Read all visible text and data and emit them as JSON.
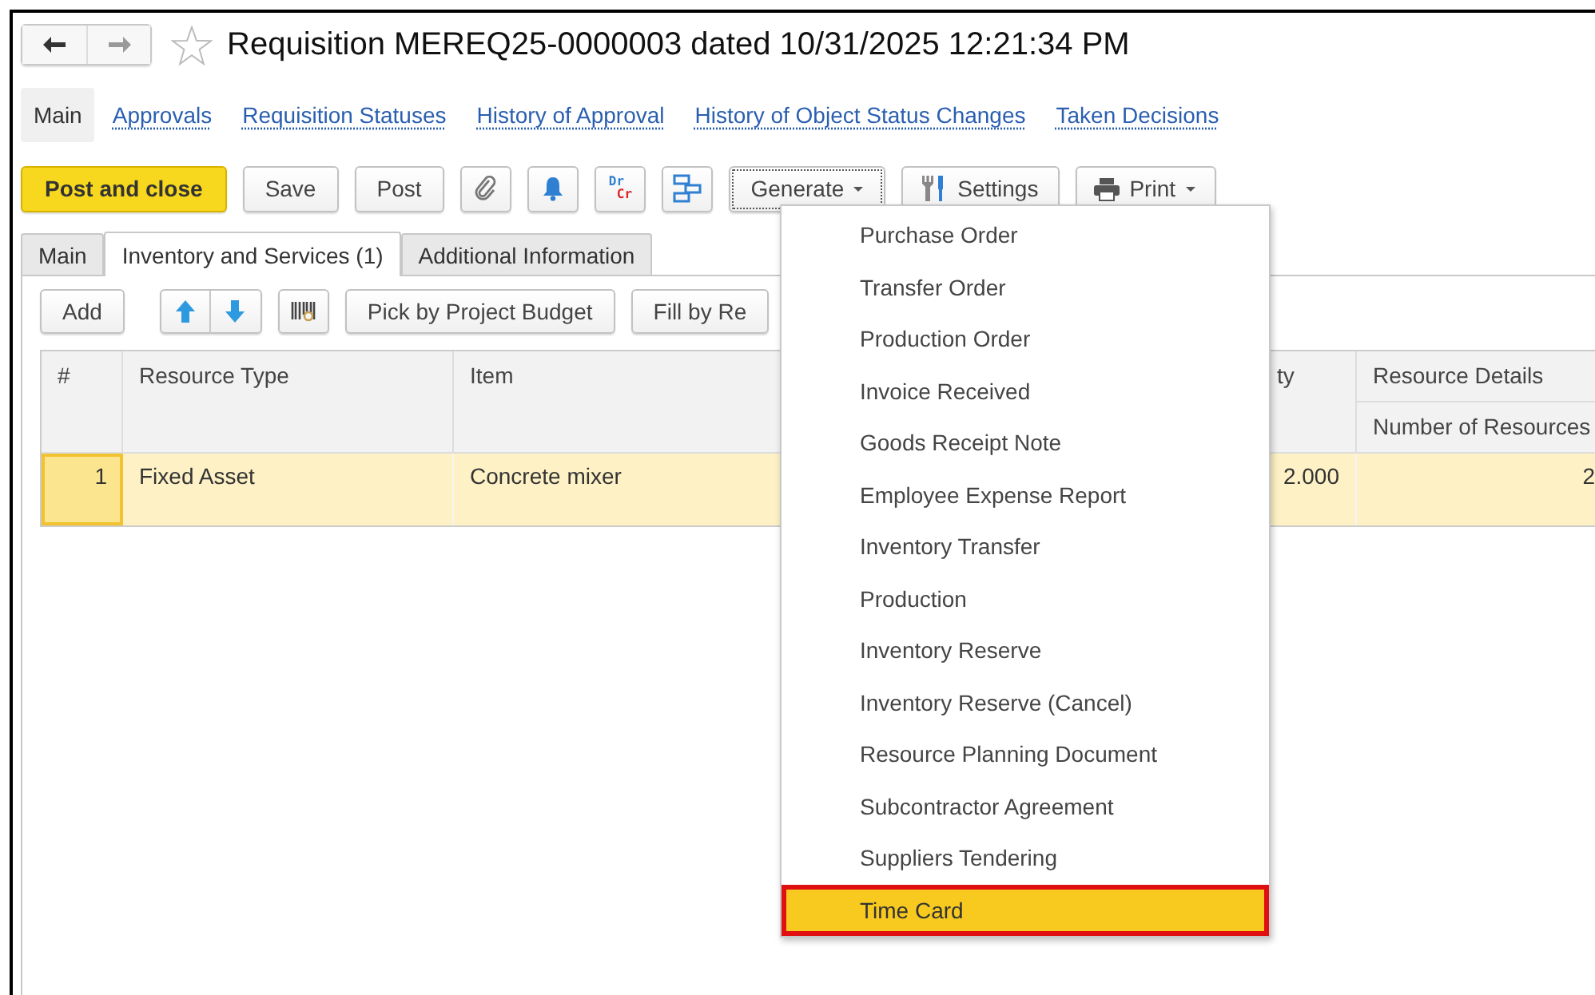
{
  "window": {
    "title": "Requisition MEREQ25-0000003 dated 10/31/2025 12:21:34 PM",
    "favorite": false
  },
  "nav_links": [
    {
      "label": "Main",
      "selected": true
    },
    {
      "label": "Approvals",
      "selected": false
    },
    {
      "label": "Requisition Statuses",
      "selected": false
    },
    {
      "label": "History of Approval",
      "selected": false
    },
    {
      "label": "History of Object Status Changes",
      "selected": false
    },
    {
      "label": "Taken Decisions",
      "selected": false
    }
  ],
  "toolbar": [
    {
      "kind": "primary",
      "label": "Post and close"
    },
    {
      "kind": "text",
      "label": "Save"
    },
    {
      "kind": "text",
      "label": "Post"
    },
    {
      "kind": "attach"
    },
    {
      "kind": "bell"
    },
    {
      "kind": "drcr",
      "top": "Dr",
      "bottom": "Cr"
    },
    {
      "kind": "structure"
    },
    {
      "kind": "dropdown",
      "label": "Generate",
      "focused": true
    },
    {
      "kind": "settings",
      "label": "Settings"
    },
    {
      "kind": "print",
      "label": "Print"
    }
  ],
  "tabs": [
    {
      "label": "Main",
      "selected": false
    },
    {
      "label": "Inventory and Services (1)",
      "selected": true
    },
    {
      "label": "Additional Information",
      "selected": false
    }
  ],
  "list_toolbar": [
    {
      "kind": "text",
      "label": "Add"
    },
    {
      "kind": "updown"
    },
    {
      "kind": "barcode"
    },
    {
      "kind": "text",
      "label": "Pick by Project Budget"
    },
    {
      "kind": "text",
      "label": "Fill by Re"
    }
  ],
  "table": {
    "columns": [
      {
        "label": "#"
      },
      {
        "label": "Resource Type"
      },
      {
        "label": "Item"
      },
      {
        "label": "ty"
      },
      {
        "label": "Resource Details",
        "sub": "Number of Resources"
      }
    ],
    "rows": [
      {
        "cells": [
          "1",
          "Fixed Asset",
          "Concrete mixer",
          "2.000",
          "2"
        ],
        "selected": true
      }
    ]
  },
  "generate_menu": {
    "items": [
      {
        "label": "Purchase Order",
        "selected": false
      },
      {
        "label": "Transfer Order",
        "selected": false
      },
      {
        "label": "Production Order",
        "selected": false
      },
      {
        "label": "Invoice Received",
        "selected": false
      },
      {
        "label": "Goods Receipt Note",
        "selected": false
      },
      {
        "label": "Employee Expense Report",
        "selected": false
      },
      {
        "label": "Inventory Transfer",
        "selected": false
      },
      {
        "label": "Production",
        "selected": false
      },
      {
        "label": "Inventory Reserve",
        "selected": false
      },
      {
        "label": "Inventory Reserve (Cancel)",
        "selected": false
      },
      {
        "label": "Resource Planning Document",
        "selected": false
      },
      {
        "label": "Subcontractor Agreement",
        "selected": false
      },
      {
        "label": "Suppliers Tendering",
        "selected": false
      },
      {
        "label": "Time Card",
        "selected": true
      }
    ]
  }
}
